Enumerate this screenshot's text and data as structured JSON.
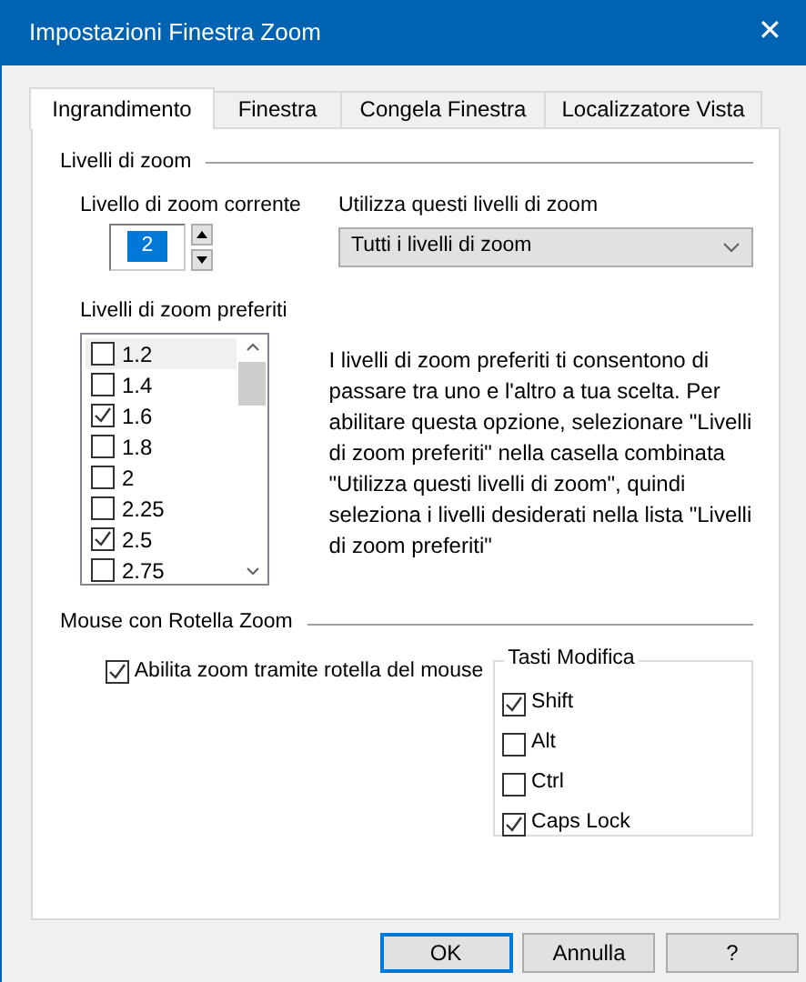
{
  "window": {
    "title": "Impostazioni Finestra Zoom",
    "close": "✕"
  },
  "tabs": [
    {
      "label": "Ingrandimento",
      "selected": true
    },
    {
      "label": "Finestra",
      "selected": false
    },
    {
      "label": "Congela Finestra",
      "selected": false
    },
    {
      "label": "Localizzatore Vista",
      "selected": false
    }
  ],
  "zoom_levels": {
    "heading": "Livelli di zoom",
    "current": {
      "label": "Livello di zoom corrente",
      "value": "2"
    },
    "use_levels": {
      "label": "Utilizza questi livelli di zoom",
      "value": "Tutti i livelli di zoom"
    },
    "preferred": {
      "label": "Livelli di zoom preferiti",
      "items": [
        {
          "label": "1.2",
          "checked": false,
          "selected": true
        },
        {
          "label": "1.4",
          "checked": false,
          "selected": false
        },
        {
          "label": "1.6",
          "checked": true,
          "selected": false
        },
        {
          "label": "1.8",
          "checked": false,
          "selected": false
        },
        {
          "label": "2",
          "checked": false,
          "selected": false
        },
        {
          "label": "2.25",
          "checked": false,
          "selected": false
        },
        {
          "label": "2.5",
          "checked": true,
          "selected": false
        },
        {
          "label": "2.75",
          "checked": false,
          "selected": false
        }
      ]
    },
    "description": "I livelli di zoom preferiti ti consentono di passare tra uno e l'altro a tua scelta. Per abilitare questa opzione, selezionare \"Livelli di zoom preferiti\" nella casella combinata \"Utilizza questi livelli di zoom\", quindi seleziona i livelli desiderati nella lista \"Livelli di zoom preferiti\""
  },
  "mouse_wheel": {
    "heading": "Mouse con Rotella Zoom",
    "enable": {
      "label": "Abilita zoom tramite rotella del mouse",
      "checked": true
    },
    "modifiers": {
      "title": "Tasti Modifica",
      "keys": [
        {
          "label": "Shift",
          "checked": true
        },
        {
          "label": "Alt",
          "checked": false
        },
        {
          "label": "Ctrl",
          "checked": false
        },
        {
          "label": "Caps Lock",
          "checked": true
        }
      ]
    }
  },
  "buttons": [
    {
      "label": "OK",
      "default": true
    },
    {
      "label": "Annulla",
      "default": false
    },
    {
      "label": "?",
      "default": false
    }
  ]
}
